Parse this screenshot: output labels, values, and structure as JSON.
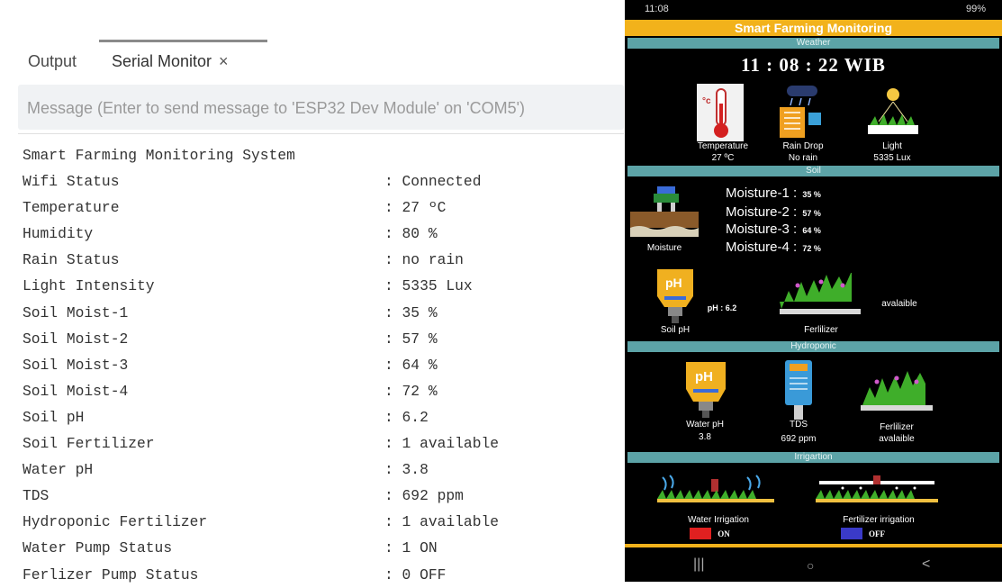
{
  "ide": {
    "tabs": [
      {
        "label": "Output"
      },
      {
        "label": "Serial Monitor"
      }
    ],
    "close_glyph": "×",
    "message_placeholder": "Message (Enter to send message to 'ESP32 Dev Module' on 'COM5')",
    "serial_lines": [
      {
        "label": "Smart Farming Monitoring System",
        "value": ""
      },
      {
        "label": "Wifi Status",
        "value": ": Connected"
      },
      {
        "label": "Temperature",
        "value": ": 27 ºC"
      },
      {
        "label": "Humidity",
        "value": ": 80 %"
      },
      {
        "label": "Rain Status",
        "value": ": no rain"
      },
      {
        "label": "Light Intensity",
        "value": ": 5335 Lux"
      },
      {
        "label": "Soil Moist-1",
        "value": ": 35 %"
      },
      {
        "label": "Soil Moist-2",
        "value": ": 57 %"
      },
      {
        "label": "Soil Moist-3",
        "value": ": 64 %"
      },
      {
        "label": "Soil Moist-4",
        "value": ": 72 %"
      },
      {
        "label": "Soil pH",
        "value": ": 6.2"
      },
      {
        "label": "Soil Fertilizer",
        "value": ": 1 available"
      },
      {
        "label": "Water pH",
        "value": ": 3.8"
      },
      {
        "label": "TDS",
        "value": ": 692 ppm"
      },
      {
        "label": "Hydroponic Fertilizer",
        "value": ": 1 available"
      },
      {
        "label": "Water Pump Status",
        "value": ": 1 ON"
      },
      {
        "label": "Ferlizer Pump Status",
        "value": ": 0 OFF"
      }
    ]
  },
  "phone": {
    "status": {
      "time": "11:08",
      "right": "99%"
    },
    "title": "Smart Farming Monitoring",
    "sections": {
      "weather": "Weather",
      "soil": "Soil",
      "hydroponic": "Hydroponic",
      "irrigation": "Irrigartion"
    },
    "clock": "11 : 08 : 22  WIB",
    "weather": {
      "temp_label": "Temperature",
      "temp_value": "27 ºC",
      "rain_label": "Rain Drop",
      "rain_value": "No rain",
      "light_label": "Light",
      "light_value": "5335 Lux"
    },
    "soil": {
      "moisture_label": "Moisture",
      "moisture": [
        {
          "name": "Moisture-1 :",
          "value": "35 %"
        },
        {
          "name": "Moisture-2 :",
          "value": "57 %"
        },
        {
          "name": "Moisture-3 :",
          "value": "64 %"
        },
        {
          "name": "Moisture-4 :",
          "value": "72 %"
        }
      ],
      "ph_text": "pH : 6.2",
      "ph_label": "Soil pH",
      "fert_label": "Ferlilizer",
      "fert_status": "avalaible"
    },
    "hydroponic": {
      "water_ph_label": "Water pH",
      "water_ph_value": "3.8",
      "tds_label": "TDS",
      "tds_value": "692  ppm",
      "fert_label": "Ferlilizer",
      "fert_value": "avalaible"
    },
    "irrigation": {
      "water_label": "Water Irrigation",
      "water_state": "ON",
      "water_color": "#e02020",
      "fert_label": "Fertilizer irrigation",
      "fert_state": "OFF",
      "fert_color": "#3a3ac8"
    },
    "colors": {
      "title_bar": "#f2b21b",
      "section_bar": "#5ca3a7"
    }
  }
}
